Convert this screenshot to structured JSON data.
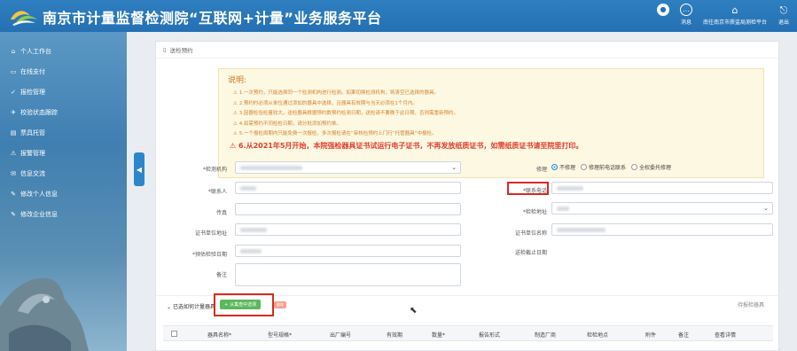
{
  "header": {
    "title": "南京市计量监督检测院“互联网+计量”业务服务平台",
    "actions": [
      {
        "label": "消息",
        "icon": "message-icon"
      },
      {
        "label": "南往南京市质监局测检平台",
        "icon": "platform-icon"
      },
      {
        "label": "退出",
        "icon": "logout-icon"
      }
    ],
    "colors": {
      "bar": "#2470b3",
      "sidebar": "#3f7fb1"
    }
  },
  "sidebar": {
    "items": [
      {
        "label": "个人工作台",
        "icon": "home-icon"
      },
      {
        "label": "在线支付",
        "icon": "card-icon"
      },
      {
        "label": "报检管理",
        "icon": "inspect-icon"
      },
      {
        "label": "校验状态跟踪",
        "icon": "track-icon"
      },
      {
        "label": "票具托管",
        "icon": "ticket-icon"
      },
      {
        "label": "报警管理",
        "icon": "alarm-icon"
      },
      {
        "label": "信息交流",
        "icon": "info-icon"
      },
      {
        "label": "修改个人信息",
        "icon": "user-edit-icon"
      },
      {
        "label": "修改企业信息",
        "icon": "company-edit-icon"
      }
    ]
  },
  "breadcrumb": "送检预约",
  "notice": {
    "title": "说明:",
    "lines": [
      "1.一次预约，只能选择同一个检测机构进行检测。如果切换检测机构，将清空已选择的器具。",
      "2.预约时必须从单位通过添加的器具中选择，且器具有效期与当天必须在1个月内。",
      "3.因器检验检量较大，送检器具根据预约数预约检测日期，送检请不要晚于此日期，否则需重新预约。",
      "4.如需预约不同检检日期，请分批添加预约单。",
      "5.一个报检周期内只能免费一次报检，多次报检请在“审核检预约上门行”托管器具“中报检。"
    ],
    "highlight": "6.从2021年5月开始，本院强检器具证书试运行电子证书，不再发放纸质证书，如需纸质证书请至院里打印。",
    "colors": {
      "bg": "#fdf8e2",
      "text": "#d4822f",
      "highlight": "#e23b2b"
    }
  },
  "form": {
    "labels": {
      "agency": "*检测机构",
      "contact": "*联系人",
      "fax": "传真",
      "cert_address": "证书单位地址",
      "expected_date": "*预估检验日期",
      "remarks": "备注",
      "repair": "修理",
      "phone": "*联系电话",
      "inspect_address": "*检检地址",
      "cert_name": "证书单位名称",
      "deadline": "送检截止日期"
    },
    "repair_options": [
      "不修理",
      "修理前电话联系",
      "全权委托修理"
    ],
    "repair_selected": "不修理"
  },
  "selected": {
    "label": "已选如何计量器具",
    "add_button": "从集查中选择",
    "tag": "删除",
    "right_label": "待报检器具"
  },
  "table": {
    "columns": [
      "器具名称*",
      "型号规格*",
      "出厂编号",
      "有效期",
      "数量*",
      "报告形式",
      "制造厂商",
      "检检地点",
      "附件",
      "备注",
      "查看详情"
    ]
  }
}
